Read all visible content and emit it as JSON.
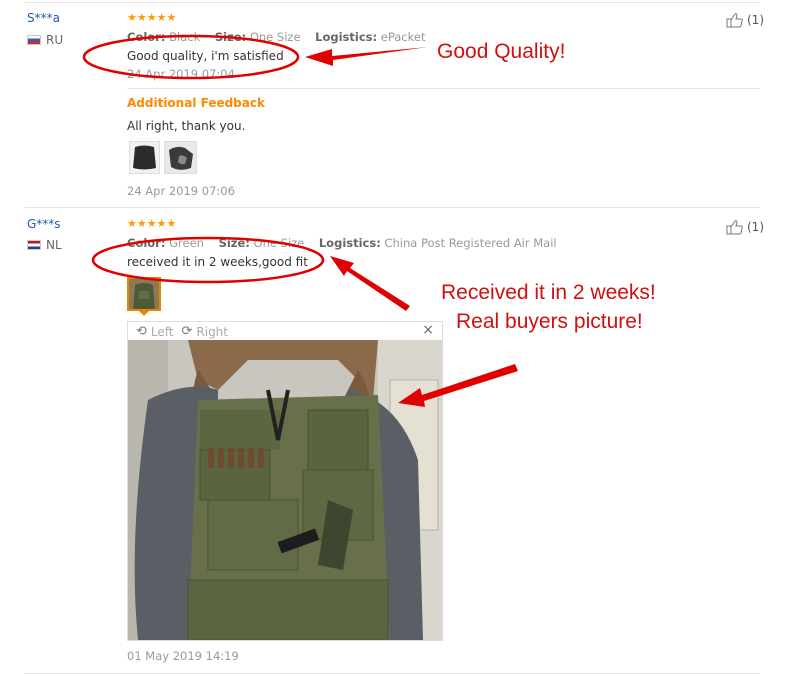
{
  "reviews": [
    {
      "user": "S***a",
      "country": "RU",
      "stars": "★★★★★",
      "color_label": "Color:",
      "color_value": "Black",
      "size_label": "Size:",
      "size_value": "One Size",
      "logistics_label": "Logistics:",
      "logistics_value": "ePacket",
      "text": "Good quality, i'm satisfied",
      "date": "24 Apr 2019 07:04",
      "helpful_count": "(1)",
      "additional_feedback_title": "Additional Feedback",
      "additional_feedback_text": "All right, thank you.",
      "additional_feedback_date": "24 Apr 2019 07:06"
    },
    {
      "user": "G***s",
      "country": "NL",
      "stars": "★★★★★",
      "color_label": "Color:",
      "color_value": "Green",
      "size_label": "Size:",
      "size_value": "One Size",
      "logistics_label": "Logistics:",
      "logistics_value": "China Post Registered Air Mail",
      "text": "received it in 2 weeks,good fit",
      "date": "01 May 2019 14:19",
      "helpful_count": "(1)",
      "viewer": {
        "rotate_left": "Left",
        "rotate_right": "Right",
        "close": "×"
      }
    }
  ],
  "annotations": {
    "first": "Good Quality!",
    "second_line1": "Received it in 2 weeks!",
    "second_line2": "Real buyers picture!"
  },
  "colors": {
    "annotation_red": "#e00000",
    "user_blue": "#1f5aa8",
    "star_orange": "#ff9900",
    "feedback_orange": "#ff8800"
  }
}
